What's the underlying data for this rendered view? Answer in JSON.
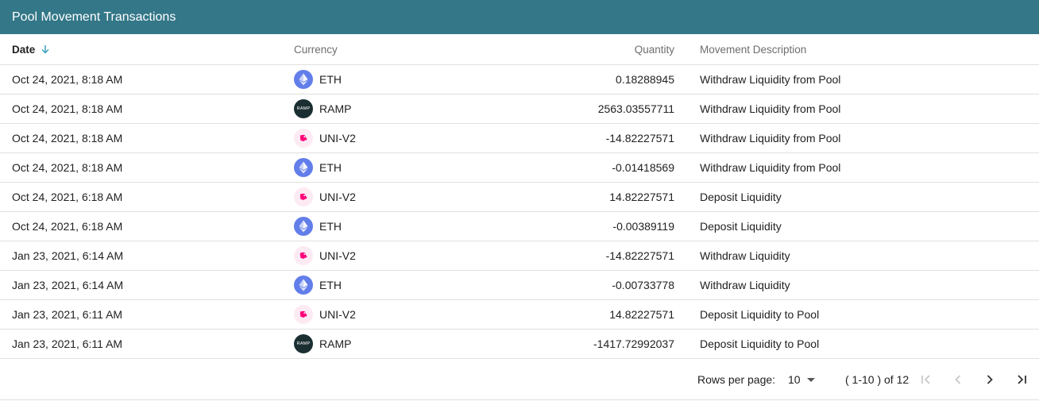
{
  "title": "Pool Movement Transactions",
  "columns": {
    "date": "Date",
    "currency": "Currency",
    "quantity": "Quantity",
    "description": "Movement Description"
  },
  "sort": {
    "column": "date",
    "direction": "descending",
    "icon": "arrow-down-icon"
  },
  "colors": {
    "header_bar": "#337788",
    "sort_arrow": "#3aa0c0",
    "eth": "#627eea",
    "ramp": "#1b2f33",
    "uni": "#ff007a"
  },
  "rows": [
    {
      "date": "Oct 24, 2021, 8:18 AM",
      "currency": "ETH",
      "icon": "eth-icon",
      "quantity": "0.18288945",
      "description": "Withdraw Liquidity from Pool"
    },
    {
      "date": "Oct 24, 2021, 8:18 AM",
      "currency": "RAMP",
      "icon": "ramp-icon",
      "icon_text": "RAMP",
      "quantity": "2563.03557711",
      "description": "Withdraw Liquidity from Pool"
    },
    {
      "date": "Oct 24, 2021, 8:18 AM",
      "currency": "UNI-V2",
      "icon": "uniswap-icon",
      "quantity": "-14.82227571",
      "description": "Withdraw Liquidity from Pool"
    },
    {
      "date": "Oct 24, 2021, 8:18 AM",
      "currency": "ETH",
      "icon": "eth-icon",
      "quantity": "-0.01418569",
      "description": "Withdraw Liquidity from Pool"
    },
    {
      "date": "Oct 24, 2021, 6:18 AM",
      "currency": "UNI-V2",
      "icon": "uniswap-icon",
      "quantity": "14.82227571",
      "description": "Deposit Liquidity"
    },
    {
      "date": "Oct 24, 2021, 6:18 AM",
      "currency": "ETH",
      "icon": "eth-icon",
      "quantity": "-0.00389119",
      "description": "Deposit Liquidity"
    },
    {
      "date": "Jan 23, 2021, 6:14 AM",
      "currency": "UNI-V2",
      "icon": "uniswap-icon",
      "quantity": "-14.82227571",
      "description": "Withdraw Liquidity"
    },
    {
      "date": "Jan 23, 2021, 6:14 AM",
      "currency": "ETH",
      "icon": "eth-icon",
      "quantity": "-0.00733778",
      "description": "Withdraw Liquidity"
    },
    {
      "date": "Jan 23, 2021, 6:11 AM",
      "currency": "UNI-V2",
      "icon": "uniswap-icon",
      "quantity": "14.82227571",
      "description": "Deposit Liquidity to Pool"
    },
    {
      "date": "Jan 23, 2021, 6:11 AM",
      "currency": "RAMP",
      "icon": "ramp-icon",
      "icon_text": "RAMP",
      "quantity": "-1417.72992037",
      "description": "Deposit Liquidity to Pool"
    }
  ],
  "pagination": {
    "rows_per_page_label": "Rows per page:",
    "rows_per_page_value": "10",
    "range_text": "( 1-10 ) of 12",
    "buttons": [
      "first-page-icon",
      "previous-page-icon",
      "next-page-icon",
      "last-page-icon"
    ]
  }
}
